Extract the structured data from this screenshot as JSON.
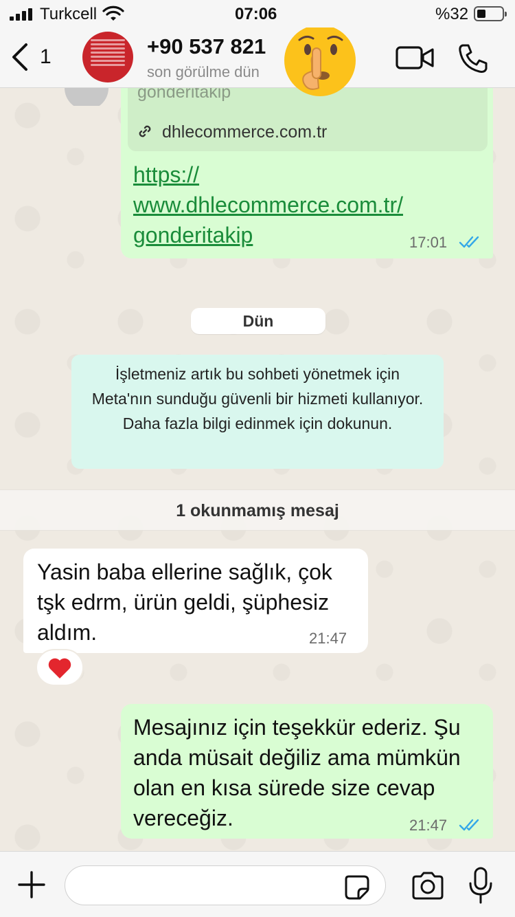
{
  "status_bar": {
    "carrier": "Turkcell",
    "time": "07:06",
    "battery_percent": "%32"
  },
  "header": {
    "back_count": "1",
    "contact_name": "+90 537 821",
    "contact_status": "son görülme dün",
    "avatar_icon": "avatar-red-text-image",
    "overlay_emoji": "shushing-face-emoji"
  },
  "messages": {
    "link_message": {
      "preview_title": "gonderitakip",
      "preview_domain": "dhlecommerce.com.tr",
      "link_line1": "https://",
      "link_line2": "www.dhlecommerce.com.tr/",
      "link_line3": "gonderitakip",
      "time": "17:01",
      "status": "read"
    },
    "date_separator": "Dün",
    "system_notice": "İşletmeniz artık bu sohbeti yönetmek için Meta'nın sunduğu güvenli bir hizmeti kullanıyor. Daha fazla bilgi edinmek için dokunun.",
    "unread_banner": "1 okunmamış mesaj",
    "incoming": {
      "text": "Yasin baba ellerine sağlık, çok tşk edrm, ürün geldi, şüphesiz aldım.",
      "time": "21:47",
      "reaction": "heart"
    },
    "outgoing_auto_reply": {
      "text": "Mesajınız için teşekkür ederiz. Şu anda müsait değiliz ama mümkün olan en kısa sürede size cevap vereceğiz.",
      "time": "21:47",
      "status": "read"
    }
  },
  "input_bar": {
    "message_value": ""
  },
  "colors": {
    "outgoing_bubble": "#d9fdd3",
    "incoming_bubble": "#ffffff",
    "link": "#1a8c3a",
    "read_ticks": "#34a8e8",
    "system_notice_bg": "#d9f7ee",
    "wallpaper": "#efeae2"
  }
}
